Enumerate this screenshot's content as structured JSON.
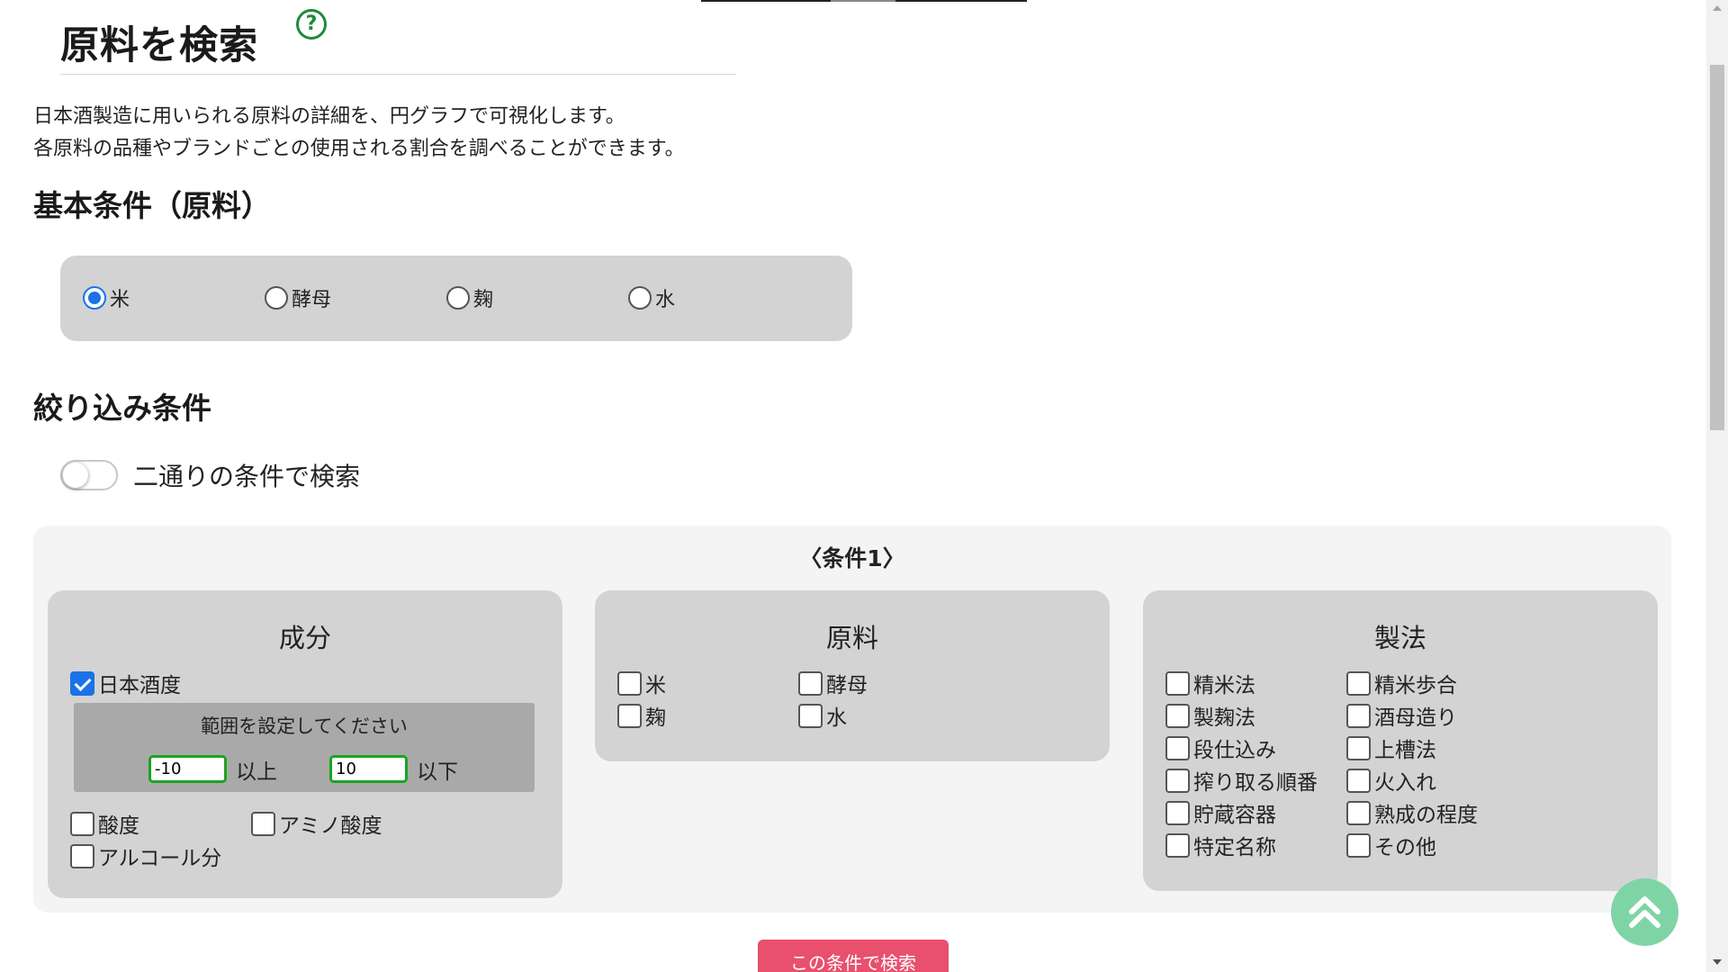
{
  "page": {
    "title": "原料を検索",
    "help_icon_glyph": "?",
    "description_line1": "日本酒製造に用いられる原料の詳細を、円グラフで可視化します。",
    "description_line2": "各原料の品種やブランドごとの使用される割合を調べることができます。"
  },
  "basic": {
    "heading": "基本条件（原料）",
    "options": [
      {
        "label": "米",
        "checked": true
      },
      {
        "label": "酵母",
        "checked": false
      },
      {
        "label": "麹",
        "checked": false
      },
      {
        "label": "水",
        "checked": false
      }
    ]
  },
  "filter": {
    "heading": "絞り込み条件",
    "toggle_label": "二通りの条件で検索",
    "toggle_on": false
  },
  "condition1": {
    "title": "〈条件1〉",
    "components": {
      "title": "成分",
      "sake_degree": {
        "label": "日本酒度",
        "checked": true
      },
      "range_prompt": "範囲を設定してください",
      "min_value": "-10",
      "min_label": "以上",
      "max_value": "10",
      "max_label": "以下",
      "acidity": {
        "label": "酸度",
        "checked": false
      },
      "amino_acidity": {
        "label": "アミノ酸度",
        "checked": false
      },
      "alcohol": {
        "label": "アルコール分",
        "checked": false
      }
    },
    "materials": {
      "title": "原料",
      "rice": "米",
      "yeast": "酵母",
      "koji": "麹",
      "water": "水"
    },
    "methods": {
      "title": "製法",
      "items": [
        "精米法",
        "精米歩合",
        "製麹法",
        "酒母造り",
        "段仕込み",
        "上槽法",
        "搾り取る順番",
        "火入れ",
        "貯蔵容器",
        "熟成の程度",
        "特定名称",
        "その他"
      ]
    }
  },
  "actions": {
    "submit_label": "この条件で検索"
  },
  "colors": {
    "accent_blue": "#1a73e8",
    "submit_pink": "#e8506e",
    "scroll_top_green": "#7fd4a6",
    "input_border_green": "#1aa520",
    "help_green": "#1f8a3a"
  },
  "icons": {
    "scroll_top": "double-chevron-up-icon",
    "help": "question-circle-icon"
  }
}
